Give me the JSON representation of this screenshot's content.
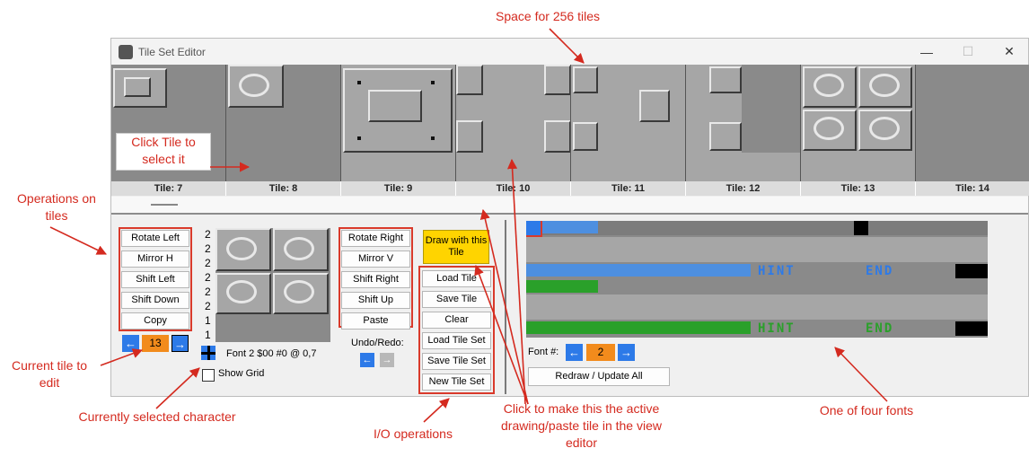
{
  "window": {
    "title": "Tile Set Editor",
    "min_icon": "minimize-icon",
    "max_icon": "maximize-icon",
    "close_icon": "close-icon"
  },
  "tile_strip": {
    "labels": [
      "Tile: 7",
      "Tile: 8",
      "Tile: 9",
      "Tile: 10",
      "Tile: 11",
      "Tile: 12",
      "Tile: 13",
      "Tile: 14"
    ]
  },
  "edit_grid": {
    "row_numbers": [
      "2",
      "2",
      "2",
      "2",
      "2",
      "2",
      "1",
      "1"
    ]
  },
  "left_ops": [
    "Rotate Left",
    "Mirror H",
    "Shift Left",
    "Shift Down",
    "Copy"
  ],
  "right_ops": [
    "Rotate Right",
    "Mirror V",
    "Shift Right",
    "Shift Up",
    "Paste"
  ],
  "draw_button": "Draw with this Tile",
  "io_ops": [
    "Load Tile",
    "Save Tile",
    "Clear",
    "Load Tile Set",
    "Save Tile Set",
    "New Tile Set"
  ],
  "current_tile": {
    "value": "13",
    "prev": "←",
    "next": "→"
  },
  "char_info": "Font 2 $00 #0 @ 0,7",
  "show_grid_label": "Show Grid",
  "undo_redo_label": "Undo/Redo:",
  "font_selector": {
    "label": "Font #:",
    "value": "2",
    "prev": "←",
    "next": "→"
  },
  "redraw_button": "Redraw / Update All",
  "font_preview": {
    "texts": [
      "HINT",
      "END",
      "HINT",
      "END"
    ]
  },
  "annotations": {
    "space_for_tiles": "Space for 256 tiles",
    "click_tile": "Click Tile to select it",
    "operations": "Operations on tiles",
    "current_tile": "Current tile to edit",
    "selected_char": "Currently selected character",
    "io_ops": "I/O operations",
    "active_tile": "Click to make this the active drawing/paste tile in the view editor",
    "one_font": "One of four fonts"
  },
  "colors": {
    "annotation": "#d42a1f",
    "accent_blue": "#2d7ae8",
    "accent_orange": "#f28b1c",
    "draw_yellow": "#ffd400"
  }
}
